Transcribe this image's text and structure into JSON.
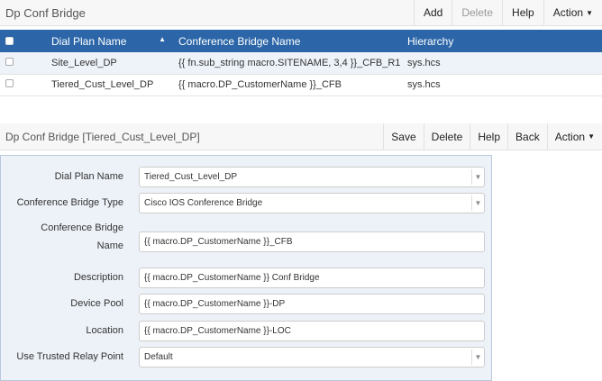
{
  "list": {
    "title": "Dp Conf Bridge",
    "buttons": [
      "Add",
      "Delete",
      "Help",
      "Action"
    ],
    "columns": [
      "Dial Plan Name",
      "Conference Bridge Name",
      "Hierarchy"
    ],
    "rows": [
      [
        "Site_Level_DP",
        "{{ fn.sub_string macro.SITENAME, 3,4 }}_CFB_R1",
        "sys.hcs"
      ],
      [
        "Tiered_Cust_Level_DP",
        "{{ macro.DP_CustomerName }}_CFB",
        "sys.hcs"
      ]
    ]
  },
  "detail": {
    "title": "Dp Conf Bridge [Tiered_Cust_Level_DP]",
    "buttons": [
      "Save",
      "Delete",
      "Help",
      "Back",
      "Action"
    ]
  },
  "form": [
    {
      "label": "Dial Plan Name",
      "value": "Tiered_Cust_Level_DP",
      "type": "select"
    },
    {
      "label": "Conference Bridge Type",
      "value": "Cisco IOS Conference Bridge",
      "type": "select"
    },
    {
      "label": "Conference Bridge Name",
      "value": "{{ macro.DP_CustomerName }}_CFB",
      "type": "text"
    },
    {
      "label": "Description",
      "value": "{{ macro.DP_CustomerName }} Conf Bridge",
      "type": "text"
    },
    {
      "label": "Device Pool",
      "value": "{{ macro.DP_CustomerName }}-DP",
      "type": "text"
    },
    {
      "label": "Location",
      "value": "{{ macro.DP_CustomerName }}-LOC",
      "type": "text"
    },
    {
      "label": "Use Trusted Relay Point",
      "value": "Default",
      "type": "select"
    }
  ]
}
